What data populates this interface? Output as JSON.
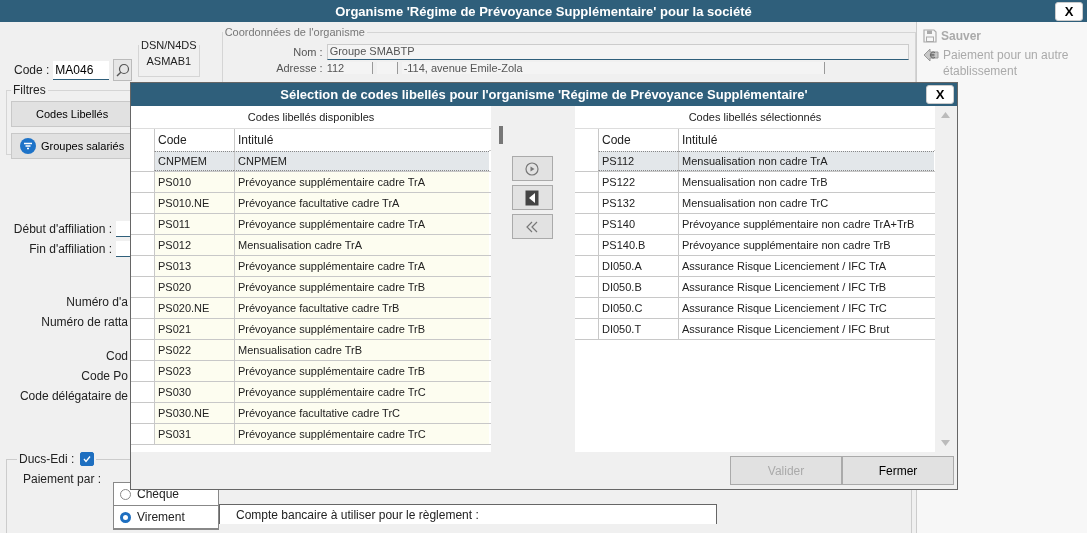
{
  "window": {
    "title": "Organisme 'Régime de Prévoyance Supplémentaire' pour la société",
    "close_label": "X"
  },
  "form": {
    "code_label": "Code :",
    "code_value": "MA046",
    "dsn": {
      "legend": "DSN/N4DS",
      "value": "ASMAB1"
    },
    "organism": {
      "legend": "Coordonnées de l'organisme",
      "name_label": "Nom :",
      "name_value": "Groupe SMABTP",
      "address_label": "Adresse :",
      "address_number": "112",
      "address_street": "-114, avenue Emile-Zola"
    },
    "filters": {
      "legend": "Filtres",
      "buttons": [
        {
          "label": "Codes Libellés",
          "kind": "plain"
        },
        {
          "label": "Groupes salariés",
          "kind": "filter"
        }
      ]
    },
    "dates": [
      {
        "label": "Début d'affiliation :"
      },
      {
        "label": "Fin d'affiliation :"
      }
    ],
    "cut_labels": [
      "Numéro d'a",
      "Numéro de ratta",
      "Cod",
      "Code Po",
      "Code délégataire de"
    ],
    "ducs_edi": {
      "label": "Ducs-Edi :",
      "checked": true
    },
    "payment": {
      "label": "Paiement par :",
      "options": [
        {
          "label": "Chèque",
          "selected": false
        },
        {
          "label": "Virement",
          "selected": true
        }
      ],
      "account_label": "Compte bancaire à utiliser pour le règlement :"
    }
  },
  "actions": [
    {
      "label": "Sauver",
      "kind": "save",
      "disabled": true
    },
    {
      "label": "Paiement pour un autre établissement",
      "kind": "payment",
      "disabled": true
    }
  ],
  "dialog": {
    "title": "Sélection de codes libellés pour l'organisme 'Régime de Prévoyance Supplémentaire'",
    "close_label": "X",
    "available": {
      "heading": "Codes libellés disponibles",
      "columns": [
        "Code",
        "Intitulé"
      ],
      "rows": [
        {
          "code": "CNPMEM",
          "label": "CNPMEM",
          "selected": true
        },
        {
          "code": "PS010",
          "label": "Prévoyance supplémentaire cadre TrA",
          "selected": false
        },
        {
          "code": "PS010.NE",
          "label": "Prévoyance facultative cadre TrA",
          "selected": false
        },
        {
          "code": "PS011",
          "label": "Prévoyance supplémentaire cadre TrA",
          "selected": false
        },
        {
          "code": "PS012",
          "label": "Mensualisation cadre TrA",
          "selected": false
        },
        {
          "code": "PS013",
          "label": "Prévoyance supplémentaire cadre TrA",
          "selected": false
        },
        {
          "code": "PS020",
          "label": "Prévoyance supplémentaire cadre TrB",
          "selected": false
        },
        {
          "code": "PS020.NE",
          "label": "Prévoyance facultative cadre TrB",
          "selected": false
        },
        {
          "code": "PS021",
          "label": "Prévoyance supplémentaire cadre TrB",
          "selected": false
        },
        {
          "code": "PS022",
          "label": "Mensualisation cadre TrB",
          "selected": false
        },
        {
          "code": "PS023",
          "label": "Prévoyance supplémentaire cadre TrB",
          "selected": false
        },
        {
          "code": "PS030",
          "label": "Prévoyance supplémentaire cadre TrC",
          "selected": false
        },
        {
          "code": "PS030.NE",
          "label": "Prévoyance facultative cadre TrC",
          "selected": false
        },
        {
          "code": "PS031",
          "label": "Prévoyance supplémentaire cadre TrC",
          "selected": false
        }
      ]
    },
    "transfer_buttons": [
      {
        "kind": "add"
      },
      {
        "kind": "remove"
      },
      {
        "kind": "remove_all"
      }
    ],
    "chosen": {
      "heading": "Codes libellés sélectionnés",
      "columns": [
        "Code",
        "Intitulé"
      ],
      "rows": [
        {
          "code": "PS112",
          "label": "Mensualisation non cadre TrA",
          "selected": true
        },
        {
          "code": "PS122",
          "label": "Mensualisation non cadre TrB",
          "selected": false
        },
        {
          "code": "PS132",
          "label": "Mensualisation non cadre TrC",
          "selected": false
        },
        {
          "code": "PS140",
          "label": "Prévoyance supplémentaire non cadre TrA+TrB",
          "selected": false
        },
        {
          "code": "PS140.B",
          "label": "Prévoyance supplémentaire non cadre TrB",
          "selected": false
        },
        {
          "code": "DI050.A",
          "label": "Assurance Risque Licenciement / IFC TrA",
          "selected": false
        },
        {
          "code": "DI050.B",
          "label": "Assurance Risque Licenciement / IFC TrB",
          "selected": false
        },
        {
          "code": "DI050.C",
          "label": "Assurance Risque Licenciement / IFC TrC",
          "selected": false
        },
        {
          "code": "DI050.T",
          "label": "Assurance Risque Licenciement / IFC Brut",
          "selected": false
        }
      ]
    },
    "footer_buttons": [
      {
        "label": "Valider",
        "disabled": true
      },
      {
        "label": "Fermer",
        "disabled": false
      }
    ]
  }
}
